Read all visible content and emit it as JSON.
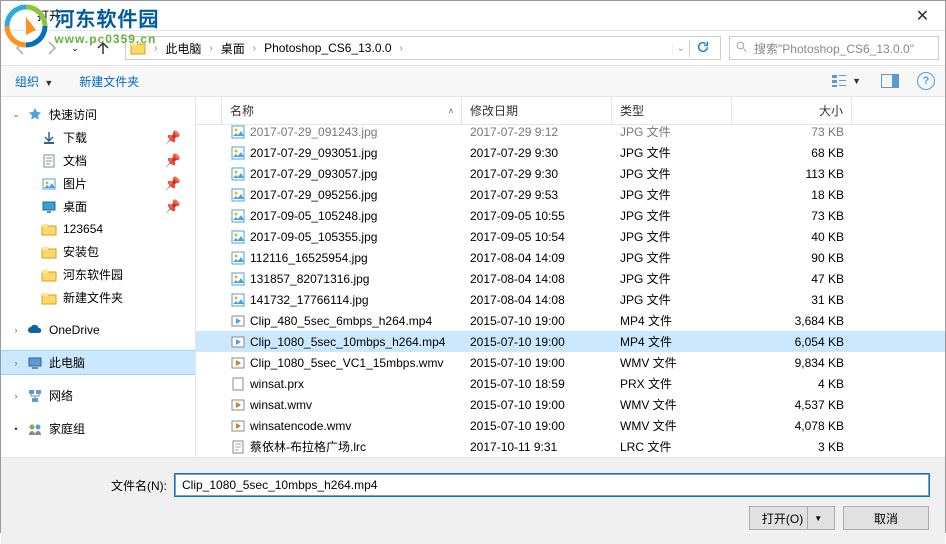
{
  "window": {
    "title": "打开",
    "close": "✕"
  },
  "watermark": {
    "cn": "河东软件园",
    "url": "www.pc0359.cn"
  },
  "breadcrumb": {
    "parts": [
      "此电脑",
      "桌面",
      "Photoshop_CS6_13.0.0"
    ]
  },
  "search": {
    "placeholder": "搜索\"Photoshop_CS6_13.0.0\""
  },
  "toolbar": {
    "organize": "组织",
    "newfolder": "新建文件夹",
    "help": "?"
  },
  "sidebar": {
    "quick": "快速访问",
    "items": [
      {
        "icon": "download",
        "label": "下载",
        "pinned": true
      },
      {
        "icon": "doc",
        "label": "文档",
        "pinned": true
      },
      {
        "icon": "pic",
        "label": "图片",
        "pinned": true
      },
      {
        "icon": "desktop",
        "label": "桌面",
        "pinned": true
      },
      {
        "icon": "folder",
        "label": "123654",
        "pinned": false
      },
      {
        "icon": "folder",
        "label": "安装包",
        "pinned": false
      },
      {
        "icon": "folder",
        "label": "河东软件园",
        "pinned": false
      },
      {
        "icon": "folder",
        "label": "新建文件夹",
        "pinned": false
      }
    ],
    "onedrive": "OneDrive",
    "thispc": "此电脑",
    "network": "网络",
    "homegroup": "家庭组"
  },
  "columns": {
    "name": "名称",
    "date": "修改日期",
    "type": "类型",
    "size": "大小"
  },
  "files": [
    {
      "icon": "jpg",
      "name": "2017-07-29_091243.jpg",
      "date": "2017-07-29 9:12",
      "type": "JPG 文件",
      "size": "73 KB",
      "truncated": true
    },
    {
      "icon": "jpg",
      "name": "2017-07-29_093051.jpg",
      "date": "2017-07-29 9:30",
      "type": "JPG 文件",
      "size": "68 KB"
    },
    {
      "icon": "jpg",
      "name": "2017-07-29_093057.jpg",
      "date": "2017-07-29 9:30",
      "type": "JPG 文件",
      "size": "113 KB"
    },
    {
      "icon": "jpg",
      "name": "2017-07-29_095256.jpg",
      "date": "2017-07-29 9:53",
      "type": "JPG 文件",
      "size": "18 KB"
    },
    {
      "icon": "jpg",
      "name": "2017-09-05_105248.jpg",
      "date": "2017-09-05 10:55",
      "type": "JPG 文件",
      "size": "73 KB"
    },
    {
      "icon": "jpg",
      "name": "2017-09-05_105355.jpg",
      "date": "2017-09-05 10:54",
      "type": "JPG 文件",
      "size": "40 KB"
    },
    {
      "icon": "jpg",
      "name": "112116_16525954.jpg",
      "date": "2017-08-04 14:09",
      "type": "JPG 文件",
      "size": "90 KB"
    },
    {
      "icon": "jpg",
      "name": "131857_82071316.jpg",
      "date": "2017-08-04 14:08",
      "type": "JPG 文件",
      "size": "47 KB"
    },
    {
      "icon": "jpg",
      "name": "141732_17766114.jpg",
      "date": "2017-08-04 14:08",
      "type": "JPG 文件",
      "size": "31 KB"
    },
    {
      "icon": "mp4",
      "name": "Clip_480_5sec_6mbps_h264.mp4",
      "date": "2015-07-10 19:00",
      "type": "MP4 文件",
      "size": "3,684 KB"
    },
    {
      "icon": "mp4",
      "name": "Clip_1080_5sec_10mbps_h264.mp4",
      "date": "2015-07-10 19:00",
      "type": "MP4 文件",
      "size": "6,054 KB",
      "selected": true
    },
    {
      "icon": "wmv",
      "name": "Clip_1080_5sec_VC1_15mbps.wmv",
      "date": "2015-07-10 19:00",
      "type": "WMV 文件",
      "size": "9,834 KB"
    },
    {
      "icon": "prx",
      "name": "winsat.prx",
      "date": "2015-07-10 18:59",
      "type": "PRX 文件",
      "size": "4 KB"
    },
    {
      "icon": "wmv",
      "name": "winsat.wmv",
      "date": "2015-07-10 19:00",
      "type": "WMV 文件",
      "size": "4,537 KB"
    },
    {
      "icon": "wmv",
      "name": "winsatencode.wmv",
      "date": "2015-07-10 19:00",
      "type": "WMV 文件",
      "size": "4,078 KB"
    },
    {
      "icon": "txt",
      "name": "蔡依林-布拉格广场.lrc",
      "date": "2017-10-11 9:31",
      "type": "LRC 文件",
      "size": "3 KB"
    }
  ],
  "bottom": {
    "filename_label": "文件名(N):",
    "filename_value": "Clip_1080_5sec_10mbps_h264.mp4",
    "open": "打开(O)",
    "cancel": "取消"
  }
}
